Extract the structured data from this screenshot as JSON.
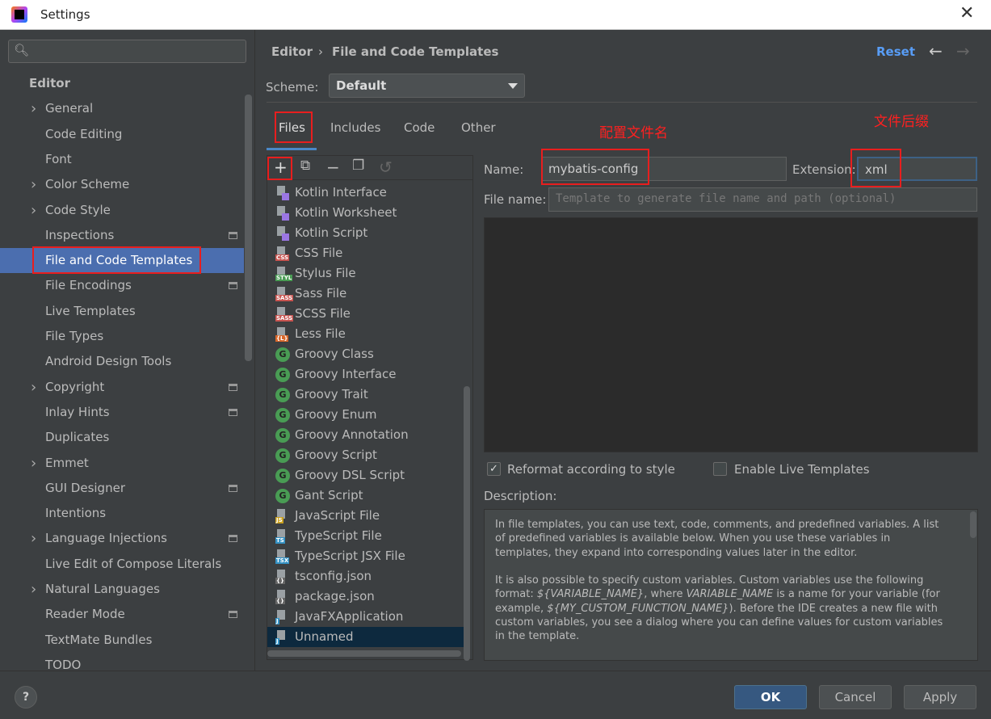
{
  "window": {
    "title": "Settings",
    "close": "✕"
  },
  "sidebar": {
    "search_icon": "🔍︎",
    "items": [
      {
        "label": "Editor",
        "type": "head"
      },
      {
        "label": "General",
        "arrow": true
      },
      {
        "label": "Code Editing"
      },
      {
        "label": "Font"
      },
      {
        "label": "Color Scheme",
        "arrow": true
      },
      {
        "label": "Code Style",
        "arrow": true
      },
      {
        "label": "Inspections",
        "proj": true
      },
      {
        "label": "File and Code Templates",
        "selected": true
      },
      {
        "label": "File Encodings",
        "proj": true
      },
      {
        "label": "Live Templates"
      },
      {
        "label": "File Types"
      },
      {
        "label": "Android Design Tools"
      },
      {
        "label": "Copyright",
        "arrow": true,
        "proj": true
      },
      {
        "label": "Inlay Hints",
        "proj": true
      },
      {
        "label": "Duplicates"
      },
      {
        "label": "Emmet",
        "arrow": true
      },
      {
        "label": "GUI Designer",
        "proj": true
      },
      {
        "label": "Intentions"
      },
      {
        "label": "Language Injections",
        "arrow": true,
        "proj": true
      },
      {
        "label": "Live Edit of Compose Literals"
      },
      {
        "label": "Natural Languages",
        "arrow": true
      },
      {
        "label": "Reader Mode",
        "proj": true
      },
      {
        "label": "TextMate Bundles"
      },
      {
        "label": "TODO"
      }
    ]
  },
  "header": {
    "crumb1": "Editor",
    "sep": "›",
    "crumb2": "File and Code Templates",
    "reset": "Reset",
    "back": "←",
    "forward": "→"
  },
  "scheme": {
    "label": "Scheme:",
    "value": "Default"
  },
  "tabs": [
    "Files",
    "Includes",
    "Code",
    "Other"
  ],
  "annotations": {
    "name": "配置文件名",
    "ext": "文件后缀"
  },
  "toolbar": {
    "add": "+",
    "add_child": "⧉",
    "remove": "−",
    "copy": "❐",
    "reset": "↺"
  },
  "files": [
    {
      "label": "Kotlin Interface",
      "icon": "kotlin"
    },
    {
      "label": "Kotlin Worksheet",
      "icon": "kotlin"
    },
    {
      "label": "Kotlin Script",
      "icon": "kotlin"
    },
    {
      "label": "CSS File",
      "icon": "doc",
      "badge": "CSS",
      "color": "#c75450"
    },
    {
      "label": "Stylus File",
      "icon": "doc",
      "badge": "STYL",
      "color": "#499c54"
    },
    {
      "label": "Sass File",
      "icon": "doc",
      "badge": "SASS",
      "color": "#c75450"
    },
    {
      "label": "SCSS File",
      "icon": "doc",
      "badge": "SASS",
      "color": "#c75450"
    },
    {
      "label": "Less File",
      "icon": "doc",
      "badge": "{L}",
      "color": "#d9672a"
    },
    {
      "label": "Groovy Class",
      "icon": "groovy"
    },
    {
      "label": "Groovy Interface",
      "icon": "groovy"
    },
    {
      "label": "Groovy Trait",
      "icon": "groovy"
    },
    {
      "label": "Groovy Enum",
      "icon": "groovy"
    },
    {
      "label": "Groovy Annotation",
      "icon": "groovy"
    },
    {
      "label": "Groovy Script",
      "icon": "groovy"
    },
    {
      "label": "Groovy DSL Script",
      "icon": "groovy"
    },
    {
      "label": "Gant Script",
      "icon": "groovy"
    },
    {
      "label": "JavaScript File",
      "icon": "doc",
      "badge": "JS",
      "color": "#c9a020"
    },
    {
      "label": "TypeScript File",
      "icon": "doc",
      "badge": "TS",
      "color": "#3592c4"
    },
    {
      "label": "TypeScript JSX File",
      "icon": "doc",
      "badge": "TSX",
      "color": "#3592c4"
    },
    {
      "label": "tsconfig.json",
      "icon": "doc",
      "badge": "{}",
      "color": "#666"
    },
    {
      "label": "package.json",
      "icon": "doc",
      "badge": "{}",
      "color": "#666"
    },
    {
      "label": "JavaFXApplication",
      "icon": "doc",
      "badge": "J",
      "color": "#3592c4"
    },
    {
      "label": "Unnamed",
      "icon": "doc",
      "badge": "J",
      "color": "#3592c4",
      "selected": true
    }
  ],
  "form": {
    "name_label": "Name:",
    "name_value": "mybatis-config",
    "ext_label": "Extension:",
    "ext_value": "xml",
    "filename_label": "File name:",
    "filename_placeholder": "Template to generate file name and path (optional)"
  },
  "options": {
    "reformat": "Reformat according to style",
    "reformat_checked": true,
    "live": "Enable Live Templates",
    "live_checked": false
  },
  "description": {
    "label": "Description:",
    "p1": "In file templates, you can use text, code, comments, and predefined variables. A list of predefined variables is available below. When you use these variables in templates, they expand into corresponding values later in the editor.",
    "p2a": "It is also possible to specify custom variables. Custom variables use the following format: ",
    "v1": "${VARIABLE_NAME}",
    "p2b": ", where ",
    "v2": "VARIABLE_NAME",
    "p2c": " is a name for your variable (for example, ",
    "v3": "${MY_CUSTOM_FUNCTION_NAME}",
    "p2d": "). Before the IDE creates a new file with custom variables, you see a dialog where you can define values for custom variables in the template."
  },
  "footer": {
    "help": "?",
    "ok": "OK",
    "cancel": "Cancel",
    "apply": "Apply"
  }
}
